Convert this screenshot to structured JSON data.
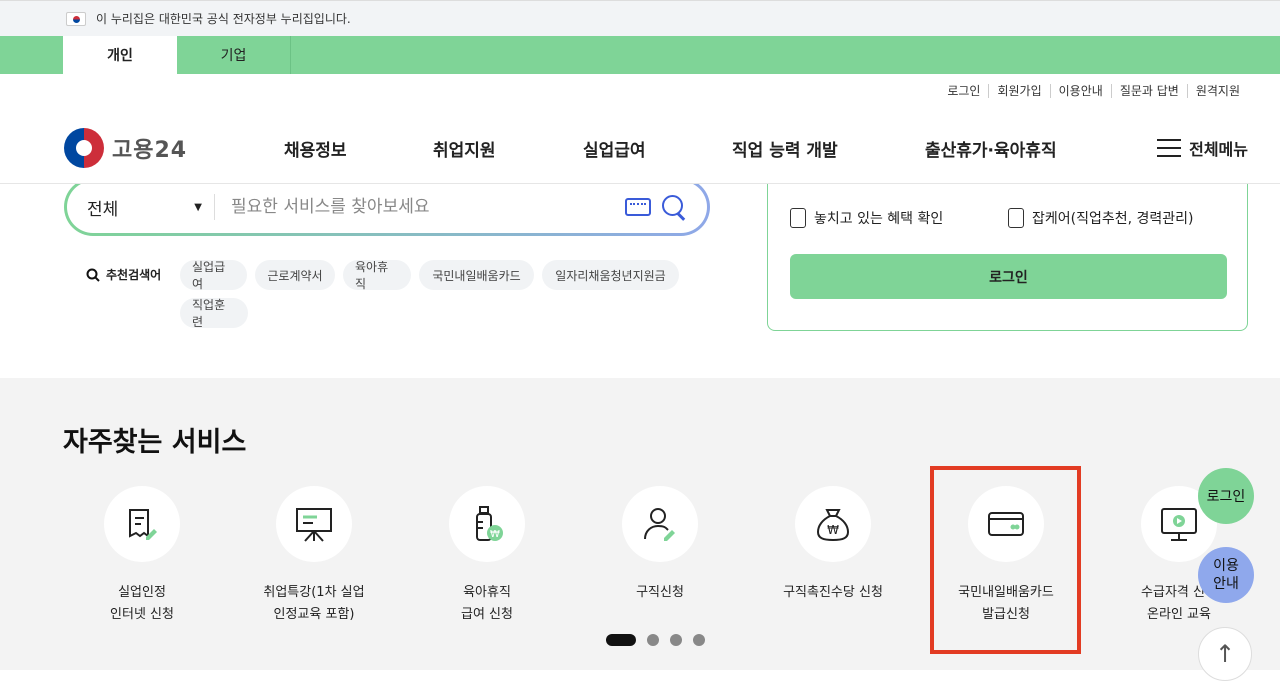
{
  "gov_banner": {
    "text": "이 누리집은 대한민국 공식 전자정부 누리집입니다."
  },
  "tabs": [
    {
      "label": "개인"
    },
    {
      "label": "기업"
    }
  ],
  "util_links": [
    "로그인",
    "회원가입",
    "이용안내",
    "질문과 답변",
    "원격지원"
  ],
  "logo": {
    "text": "고용24"
  },
  "nav": [
    "채용정보",
    "취업지원",
    "실업급여",
    "직업 능력 개발",
    "출산휴가·육아휴직"
  ],
  "menu_all": "전체메뉴",
  "search": {
    "category": "전체",
    "placeholder": "필요한 서비스를 찾아보세요"
  },
  "recommended": {
    "label": "추천검색어",
    "chips": [
      "실업급여",
      "근로계약서",
      "육아휴직",
      "국민내일배움카드",
      "일자리채움청년지원금",
      "직업훈련"
    ]
  },
  "login_panel": {
    "items": [
      "놓치고 있는 혜택 확인",
      "잡케어(직업추천, 경력관리)"
    ],
    "login_button": "로그인"
  },
  "services": {
    "title": "자주찾는 서비스",
    "items": [
      {
        "line1": "실업인정",
        "line2": "인터넷 신청",
        "icon": "document-pen-icon"
      },
      {
        "line1": "취업특강(1차 실업",
        "line2": "인정교육 포함)",
        "icon": "presentation-board-icon"
      },
      {
        "line1": "육아휴직",
        "line2": "급여 신청",
        "icon": "baby-bottle-won-icon"
      },
      {
        "line1": "구직신청",
        "line2": "",
        "icon": "person-pen-icon"
      },
      {
        "line1": "구직촉진수당 신청",
        "line2": "",
        "icon": "money-bag-icon"
      },
      {
        "line1": "국민내일배움카드",
        "line2": "발급신청",
        "icon": "card-icon"
      },
      {
        "line1": "수급자격 신청",
        "line2": "온라인 교육",
        "icon": "monitor-play-icon"
      }
    ]
  },
  "carousel": {
    "current": 1,
    "total": 4
  },
  "floating": {
    "login": "로그인",
    "guide_line1": "이용",
    "guide_line2": "안내",
    "top": "↑"
  },
  "colors": {
    "accent_green": "#7fd497",
    "accent_blue": "#8fa8ec",
    "highlight": "#e23b22"
  }
}
